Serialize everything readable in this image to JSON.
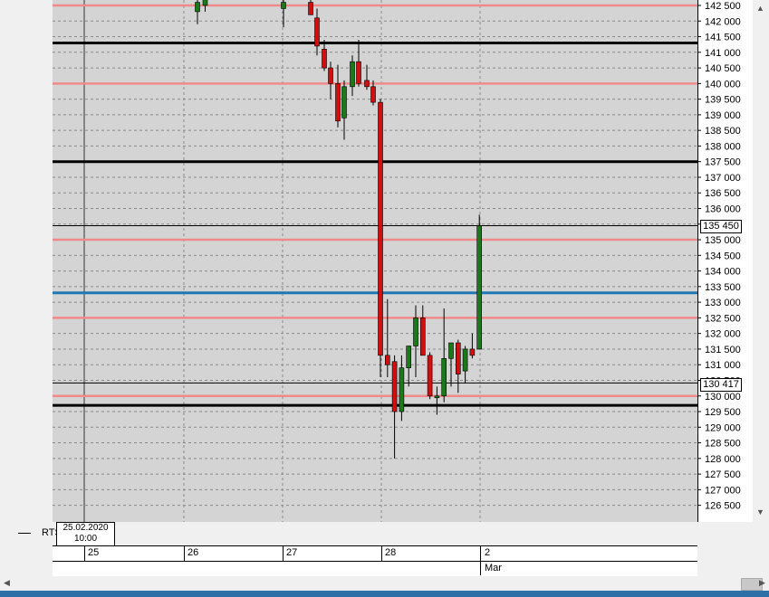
{
  "chart_data": {
    "type": "candlestick",
    "symbol": "RTS",
    "ylim": [
      126000,
      142750
    ],
    "y_ticks": [
      "126 500",
      "127 000",
      "127 500",
      "128 000",
      "128 500",
      "129 000",
      "129 500",
      "130 000",
      "130 500",
      "131 000",
      "131 500",
      "132 000",
      "132 500",
      "133 000",
      "133 500",
      "134 000",
      "134 500",
      "135 000",
      "135 500",
      "136 000",
      "136 500",
      "137 000",
      "137 500",
      "138 000",
      "138 500",
      "139 000",
      "139 500",
      "140 000",
      "140 500",
      "141 000",
      "141 500",
      "142 000",
      "142 500"
    ],
    "x_day_labels": [
      "25",
      "26",
      "27",
      "28",
      "2"
    ],
    "x_month_label": "Mar",
    "crosshair_label": [
      "25.02.2020",
      "10:00"
    ],
    "last_price_tag": "135 450",
    "cursor_price_tag": "130 417",
    "horizontal_levels": [
      {
        "price": 142500,
        "color": "#f08a8a"
      },
      {
        "price": 141300,
        "color": "#000000"
      },
      {
        "price": 140000,
        "color": "#f08a8a"
      },
      {
        "price": 137500,
        "color": "#000000"
      },
      {
        "price": 135000,
        "color": "#f08a8a"
      },
      {
        "price": 133300,
        "color": "#1f77b4"
      },
      {
        "price": 132500,
        "color": "#f08a8a"
      },
      {
        "price": 130000,
        "color": "#f08a8a"
      },
      {
        "price": 129700,
        "color": "#000000"
      }
    ],
    "colors": {
      "up": "#1a7a1a",
      "down": "#d01010",
      "background": "#d4d4d4"
    },
    "candles": [
      {
        "o": 142300,
        "h": 142900,
        "l": 141900,
        "c": 142600
      },
      {
        "o": 142500,
        "h": 142900,
        "l": 142300,
        "c": 142800
      },
      {
        "o": 142400,
        "h": 142900,
        "l": 141800,
        "c": 142600
      },
      {
        "o": 142600,
        "h": 142900,
        "l": 142200,
        "c": 142200
      },
      {
        "o": 142100,
        "h": 142400,
        "l": 140900,
        "c": 141200
      },
      {
        "o": 141100,
        "h": 141400,
        "l": 140400,
        "c": 140500
      },
      {
        "o": 140500,
        "h": 140700,
        "l": 139500,
        "c": 140000
      },
      {
        "o": 140000,
        "h": 140600,
        "l": 138600,
        "c": 138800
      },
      {
        "o": 138900,
        "h": 140100,
        "l": 138200,
        "c": 139900
      },
      {
        "o": 139900,
        "h": 140900,
        "l": 139600,
        "c": 140700
      },
      {
        "o": 140700,
        "h": 141400,
        "l": 139900,
        "c": 140000
      },
      {
        "o": 140100,
        "h": 140600,
        "l": 139800,
        "c": 139900
      },
      {
        "o": 139900,
        "h": 140100,
        "l": 139300,
        "c": 139400
      },
      {
        "o": 139400,
        "h": 139500,
        "l": 130600,
        "c": 131300
      },
      {
        "o": 131300,
        "h": 133100,
        "l": 130600,
        "c": 131000
      },
      {
        "o": 131100,
        "h": 131300,
        "l": 128000,
        "c": 129500
      },
      {
        "o": 129500,
        "h": 131300,
        "l": 129200,
        "c": 130900
      },
      {
        "o": 130900,
        "h": 131500,
        "l": 130300,
        "c": 131600
      },
      {
        "o": 131600,
        "h": 132900,
        "l": 130600,
        "c": 132500
      },
      {
        "o": 132500,
        "h": 132900,
        "l": 131300,
        "c": 131300
      },
      {
        "o": 131300,
        "h": 131400,
        "l": 129900,
        "c": 130000
      },
      {
        "o": 130000,
        "h": 130300,
        "l": 129400,
        "c": 130000
      },
      {
        "o": 130000,
        "h": 132800,
        "l": 129800,
        "c": 131200
      },
      {
        "o": 131200,
        "h": 131700,
        "l": 130300,
        "c": 131700
      },
      {
        "o": 131700,
        "h": 131800,
        "l": 130100,
        "c": 130700
      },
      {
        "o": 130800,
        "h": 131600,
        "l": 130400,
        "c": 131500
      },
      {
        "o": 131500,
        "h": 132000,
        "l": 131200,
        "c": 131300
      },
      {
        "o": 131500,
        "h": 135800,
        "l": 131500,
        "c": 135450
      }
    ]
  }
}
